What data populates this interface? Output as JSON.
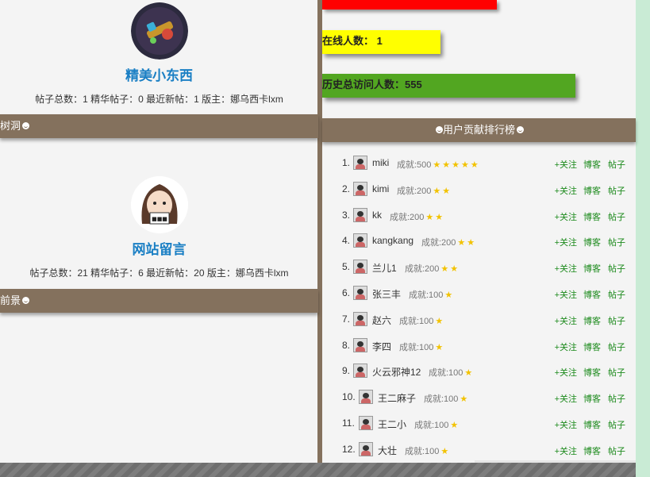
{
  "forums": [
    {
      "title": "精美小东西",
      "stats": "帖子总数：1 精华帖子：0 最近新帖：1 版主：娜乌西卡lxm",
      "category_after": "树洞"
    },
    {
      "title": "网站留言",
      "stats": "帖子总数：21 精华帖子：6 最近新帖：20 版主：娜乌西卡lxm",
      "category_after": "前景"
    }
  ],
  "site_stats": {
    "online": "在线人数： 1",
    "history": "历史总访问人数：555",
    "colors": {
      "top": "#ff0000",
      "online": "#ffff00",
      "history": "#52a621"
    }
  },
  "ranking": {
    "title": "用户贡献排行榜",
    "follow_label": "+关注",
    "blog_label": "博客",
    "post_label": "帖子",
    "users": [
      {
        "rank": "1.",
        "name": "miki",
        "score": "成就:500",
        "stars": 5
      },
      {
        "rank": "2.",
        "name": "kimi",
        "score": "成就:200",
        "stars": 2
      },
      {
        "rank": "3.",
        "name": "kk",
        "score": "成就:200",
        "stars": 2
      },
      {
        "rank": "4.",
        "name": "kangkang",
        "score": "成就:200",
        "stars": 2
      },
      {
        "rank": "5.",
        "name": "兰儿1",
        "score": "成就:200",
        "stars": 2
      },
      {
        "rank": "6.",
        "name": "张三丰",
        "score": "成就:100",
        "stars": 1
      },
      {
        "rank": "7.",
        "name": "赵六",
        "score": "成就:100",
        "stars": 1
      },
      {
        "rank": "8.",
        "name": "李四",
        "score": "成就:100",
        "stars": 1
      },
      {
        "rank": "9.",
        "name": "火云邪神12",
        "score": "成就:100",
        "stars": 1
      },
      {
        "rank": "10.",
        "name": "王二麻子",
        "score": "成就:100",
        "stars": 1
      },
      {
        "rank": "11.",
        "name": "王二小",
        "score": "成就:100",
        "stars": 1
      },
      {
        "rank": "12.",
        "name": "大壮",
        "score": "成就:100",
        "stars": 1
      }
    ]
  }
}
